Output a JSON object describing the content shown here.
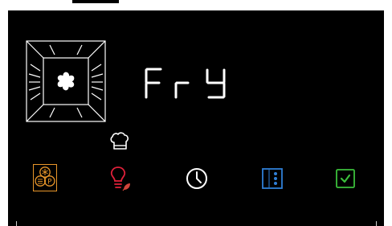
{
  "display": {
    "mode_text": "Fry"
  },
  "icons": {
    "oven": "oven-fan-icon",
    "chef": "chef-hat-icon",
    "program": "program-icon",
    "light": "light-bulb-icon",
    "clock": "clock-icon",
    "menu": "menu-dots-icon",
    "confirm": "checkmark-icon"
  },
  "colors": {
    "background": "#000000",
    "program_accent": "#e8962a",
    "light_accent": "#e0203a",
    "leaf_accent": "#d0443a",
    "menu_accent": "#2f7fd6",
    "confirm_accent": "#3bbf3b",
    "segment_text": "#ffffff"
  }
}
